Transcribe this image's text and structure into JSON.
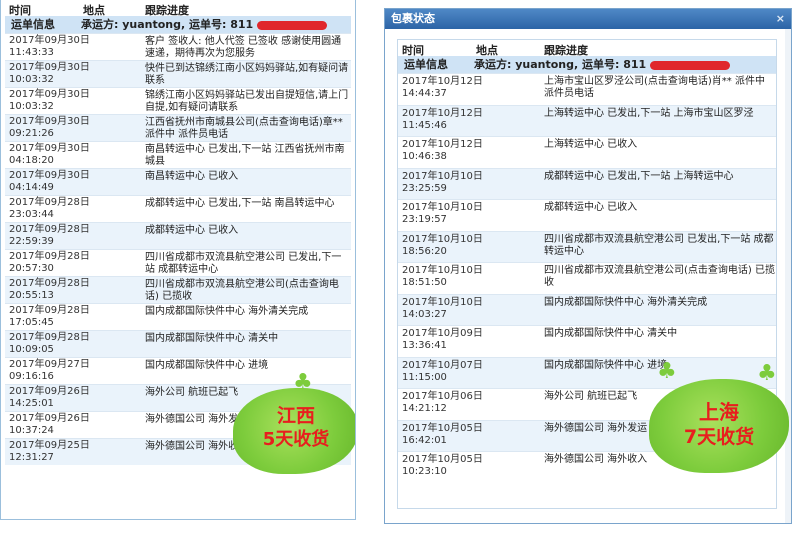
{
  "headers": {
    "time": "时间",
    "place": "地点",
    "progress": "跟踪进度"
  },
  "left": {
    "waybill": {
      "label": "运单信息",
      "text": "承运方: yuantong, 运单号: 811"
    },
    "rows": [
      {
        "time": "2017年09月30日 11:43:33",
        "desc": "客户 签收人: 他人代签 已签收 感谢使用圆通速递，期待再次为您服务"
      },
      {
        "time": "2017年09月30日 10:03:32",
        "desc": "快件已到达锦绣江南小区妈妈驿站,如有疑问请联系"
      },
      {
        "time": "2017年09月30日 10:03:32",
        "desc": "锦绣江南小区妈妈驿站已发出自提短信,请上门自提,如有疑问请联系"
      },
      {
        "time": "2017年09月30日 09:21:26",
        "desc": "江西省抚州市南城县公司(点击查询电话)章** 派件中 派件员电话"
      },
      {
        "time": "2017年09月30日 04:18:20",
        "desc": "南昌转运中心 已发出,下一站 江西省抚州市南城县"
      },
      {
        "time": "2017年09月30日 04:14:49",
        "desc": "南昌转运中心 已收入"
      },
      {
        "time": "2017年09月28日 23:03:44",
        "desc": "成都转运中心 已发出,下一站 南昌转运中心"
      },
      {
        "time": "2017年09月28日 22:59:39",
        "desc": "成都转运中心 已收入"
      },
      {
        "time": "2017年09月28日 20:57:30",
        "desc": "四川省成都市双流县航空港公司 已发出,下一站 成都转运中心"
      },
      {
        "time": "2017年09月28日 20:55:13",
        "desc": "四川省成都市双流县航空港公司(点击查询电话) 已揽收"
      },
      {
        "time": "2017年09月28日 17:05:45",
        "desc": "国内成都国际快件中心 海外清关完成"
      },
      {
        "time": "2017年09月28日 10:09:05",
        "desc": "国内成都国际快件中心 清关中"
      },
      {
        "time": "2017年09月27日 09:16:16",
        "desc": "国内成都国际快件中心 进境"
      },
      {
        "time": "2017年09月26日 14:25:01",
        "desc": "海外公司 航班已起飞"
      },
      {
        "time": "2017年09月26日 10:37:24",
        "desc": "海外德国公司 海外发运"
      },
      {
        "time": "2017年09月25日 12:31:27",
        "desc": "海外德国公司 海外收入"
      }
    ],
    "sticker": {
      "line1": "江西",
      "line2": "5天收货"
    }
  },
  "right": {
    "title": "包裹状态",
    "close": "×",
    "waybill": {
      "label": "运单信息",
      "text": "承运方: yuantong, 运单号: 811"
    },
    "rows": [
      {
        "time": "2017年10月12日 14:44:37",
        "desc": "上海市宝山区罗泾公司(点击查询电话)肖** 派件中 派件员电话"
      },
      {
        "time": "2017年10月12日 11:45:46",
        "desc": "上海转运中心 已发出,下一站 上海市宝山区罗泾"
      },
      {
        "time": "2017年10月12日 10:46:38",
        "desc": "上海转运中心 已收入"
      },
      {
        "time": "2017年10月10日 23:25:59",
        "desc": "成都转运中心 已发出,下一站 上海转运中心"
      },
      {
        "time": "2017年10月10日 23:19:57",
        "desc": "成都转运中心 已收入"
      },
      {
        "time": "2017年10月10日 18:56:20",
        "desc": "四川省成都市双流县航空港公司 已发出,下一站 成都转运中心"
      },
      {
        "time": "2017年10月10日 18:51:50",
        "desc": "四川省成都市双流县航空港公司(点击查询电话) 已揽收"
      },
      {
        "time": "2017年10月10日 14:03:27",
        "desc": "国内成都国际快件中心 海外清关完成"
      },
      {
        "time": "2017年10月09日 13:36:41",
        "desc": "国内成都国际快件中心 清关中"
      },
      {
        "time": "2017年10月07日 11:15:00",
        "desc": "国内成都国际快件中心 进境"
      },
      {
        "time": "2017年10月06日 14:21:12",
        "desc": "海外公司 航班已起飞"
      },
      {
        "time": "2017年10月05日 16:42:01",
        "desc": "海外德国公司 海外发运"
      },
      {
        "time": "2017年10月05日 10:23:10",
        "desc": "海外德国公司 海外收入"
      }
    ],
    "sticker": {
      "line1": "上海",
      "line2": "7天收货"
    }
  },
  "colors": {
    "titlebar": "#3a72b4",
    "waybill_bg": "#cfe3f5",
    "alt_row": "#eaf3fb",
    "redaction": "#e0262c",
    "sticker_green": "#7dcc3c",
    "sticker_text": "#e81e1e"
  }
}
